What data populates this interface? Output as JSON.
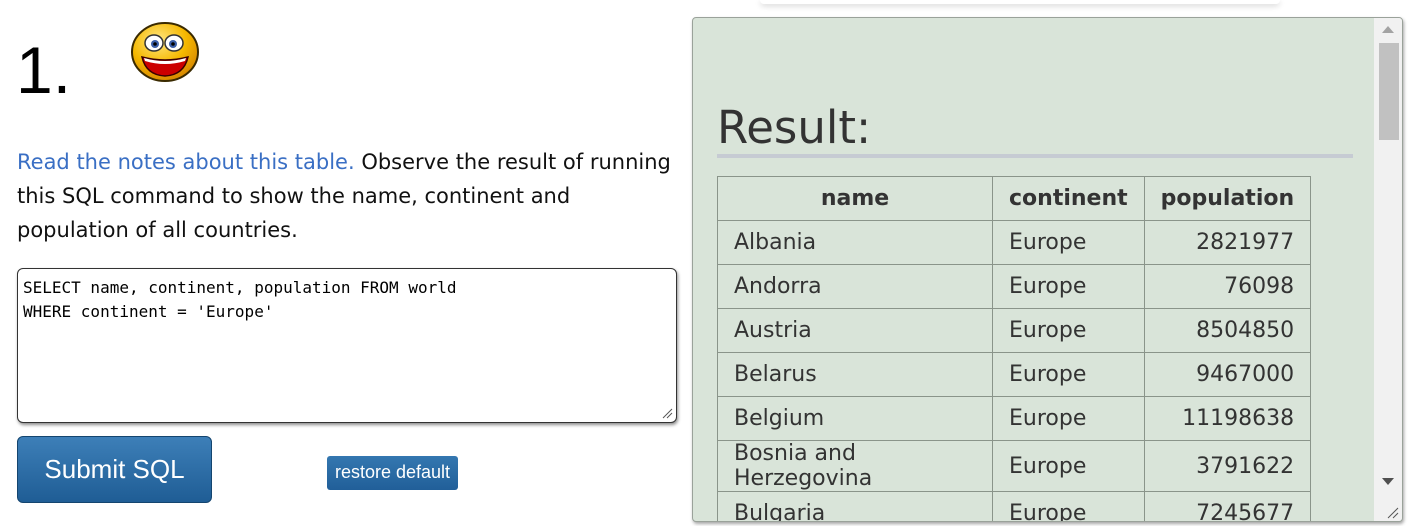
{
  "question": {
    "number": "1.",
    "emoji": "smiley-icon"
  },
  "intro": {
    "link_text": "Read the notes about this table.",
    "text": " Observe the result of running this SQL command to show the name, continent and population of all countries."
  },
  "sql_editor": {
    "value": "SELECT name, continent, population FROM world\nWHERE continent = 'Europe'"
  },
  "buttons": {
    "submit_label": "Submit SQL",
    "restore_label": "restore default"
  },
  "result": {
    "heading": "Result:",
    "columns": [
      "name",
      "continent",
      "population"
    ],
    "rows": [
      [
        "Albania",
        "Europe",
        "2821977"
      ],
      [
        "Andorra",
        "Europe",
        "76098"
      ],
      [
        "Austria",
        "Europe",
        "8504850"
      ],
      [
        "Belarus",
        "Europe",
        "9467000"
      ],
      [
        "Belgium",
        "Europe",
        "11198638"
      ],
      [
        "Bosnia and Herzegovina",
        "Europe",
        "3791622"
      ],
      [
        "Bulgaria",
        "Europe",
        "7245677"
      ]
    ]
  },
  "colors": {
    "link": "#3a6fc4",
    "button": "#2a6aa6",
    "panel_bg": "#d9e4d9"
  }
}
